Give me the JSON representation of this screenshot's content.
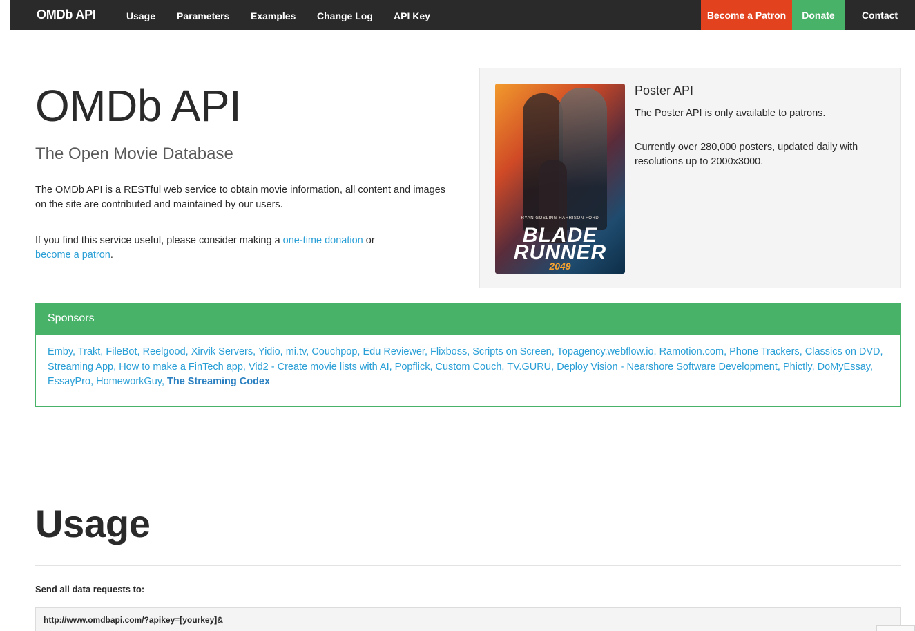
{
  "navbar": {
    "brand": "OMDb API",
    "links": [
      "Usage",
      "Parameters",
      "Examples",
      "Change Log",
      "API Key"
    ],
    "patron_button": "Become a Patron",
    "donate_button": "Donate",
    "contact_button": "Contact",
    "colors": {
      "bar": "#2a2a2a",
      "patron": "#e2431e",
      "donate": "#47b268"
    }
  },
  "hero": {
    "title": "OMDb API",
    "subtitle": "The Open Movie Database",
    "paragraph1": "The OMDb API is a RESTful web service to obtain movie information, all content and images on the site are contributed and maintained by our users.",
    "paragraph2_prefix": "If you find this service useful, please consider making a ",
    "donation_link": "one-time donation",
    "paragraph2_middle": " or ",
    "patron_link": "become a patron",
    "paragraph2_suffix": "."
  },
  "poster_card": {
    "title": "Poster API",
    "line1": "The Poster API is only available to patrons.",
    "line2": "Currently over 280,000 posters, updated daily with resolutions up to 2000x3000.",
    "poster": {
      "names": "RYAN GOSLING   HARRISON FORD",
      "title_line1": "BLADE",
      "title_line2": "RUNNER",
      "year": "2049"
    }
  },
  "sponsors": {
    "heading": "Sponsors",
    "items": [
      "Emby",
      "Trakt",
      "FileBot",
      "Reelgood",
      "Xirvik Servers",
      "Yidio",
      "mi.tv",
      "Couchpop",
      "Edu Reviewer",
      "Flixboss",
      "Scripts on Screen",
      "Topagency.webflow.io",
      "Ramotion.com",
      "Phone Trackers",
      "Classics on DVD",
      "Streaming App",
      "How to make a FinTech app",
      "Vid2 - Create movie lists with AI",
      "Popflick",
      "Custom Couch",
      "TV.GURU",
      "Deploy Vision - Nearshore Software Development",
      "Phictly",
      "DoMyEssay",
      "EssayPro",
      "HomeworkGuy"
    ],
    "featured": "The Streaming Codex",
    "color": "#47b268"
  },
  "usage": {
    "title": "Usage",
    "label": "Send all data requests to:",
    "url": "http://www.omdbapi.com/?apikey=[yourkey]&"
  }
}
